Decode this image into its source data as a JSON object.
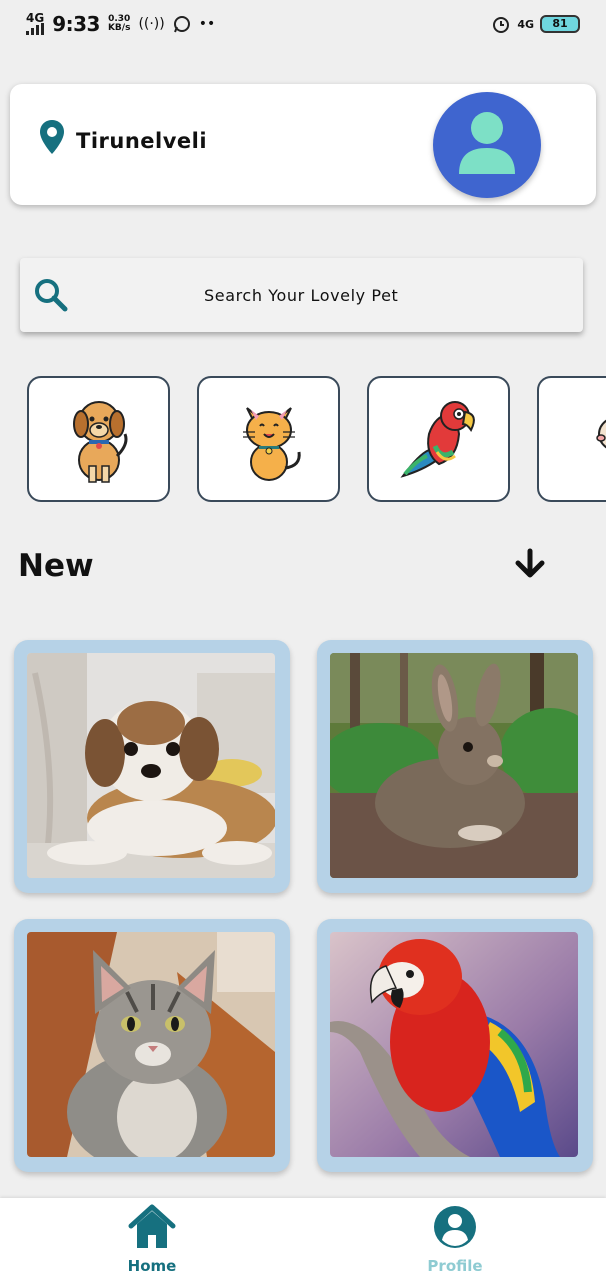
{
  "status_bar": {
    "network": "4G",
    "time": "9:33",
    "speed_value": "0.30",
    "speed_unit": "KB/s",
    "extra": "••",
    "network_right": "4G",
    "battery": "81"
  },
  "location": {
    "city": "Tirunelveli",
    "pin_icon": "map-pin-icon",
    "avatar_icon": "user-avatar-icon"
  },
  "search": {
    "placeholder": "Search Your Lovely Pet",
    "icon": "search-icon"
  },
  "categories": [
    {
      "icon": "dog-icon"
    },
    {
      "icon": "cat-icon"
    },
    {
      "icon": "parrot-icon"
    },
    {
      "icon": "rabbit-icon"
    }
  ],
  "section": {
    "title": "New",
    "arrow_icon": "arrow-down-icon"
  },
  "pets": [
    {
      "photo": "shih-tzu-dog-photo"
    },
    {
      "photo": "rabbit-photo"
    },
    {
      "photo": "tabby-kitten-photo"
    },
    {
      "photo": "macaw-parrot-photo"
    }
  ],
  "bottom_nav": {
    "home_label": "Home",
    "profile_label": "Profile"
  },
  "colors": {
    "teal": "#16707f",
    "card_border": "#b6d2e7",
    "avatar_bg": "#3f65cf",
    "profile_inactive": "#8ecbd2"
  }
}
